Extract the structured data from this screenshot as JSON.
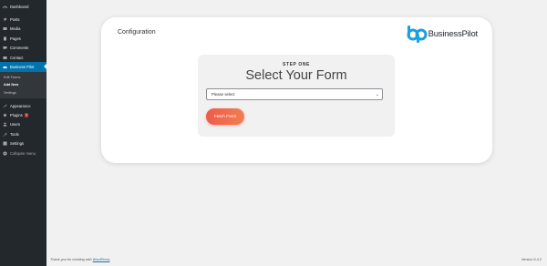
{
  "sidebar": {
    "items": [
      {
        "label": "Dashboard",
        "icon": "dashboard-icon"
      },
      {
        "label": "Posts",
        "icon": "pin-icon"
      },
      {
        "label": "Media",
        "icon": "media-icon"
      },
      {
        "label": "Pages",
        "icon": "page-icon"
      },
      {
        "label": "Comments",
        "icon": "comment-icon"
      },
      {
        "label": "Contact",
        "icon": "mail-icon"
      },
      {
        "label": "Business Pilot",
        "icon": "business-pilot-icon"
      }
    ],
    "submenu": [
      {
        "label": "Edit Forms"
      },
      {
        "label": "Add New"
      },
      {
        "label": "Settings"
      }
    ],
    "items2": [
      {
        "label": "Appearance",
        "icon": "brush-icon"
      },
      {
        "label": "Plugins",
        "icon": "plugin-icon",
        "badge": "1"
      },
      {
        "label": "Users",
        "icon": "user-icon"
      },
      {
        "label": "Tools",
        "icon": "wrench-icon"
      },
      {
        "label": "Settings",
        "icon": "settings-icon"
      },
      {
        "label": "Collapse menu",
        "icon": "collapse-icon"
      }
    ]
  },
  "card": {
    "title": "Configuration",
    "logo_text": "BusinessPilot"
  },
  "form": {
    "step": "STEP ONE",
    "heading": "Select Your Form",
    "select_value": "Please select",
    "button": "Fetch Form"
  },
  "footer": {
    "thanks_prefix": "Thank you for creating with ",
    "thanks_link": "WordPress",
    "version": "Version 5.4.2"
  },
  "colors": {
    "sidebar_bg": "#23282d",
    "active_bg": "#0073aa",
    "brand_blue": "#1a9fe0",
    "button_start": "#f05a4a",
    "button_end": "#f07f52"
  }
}
